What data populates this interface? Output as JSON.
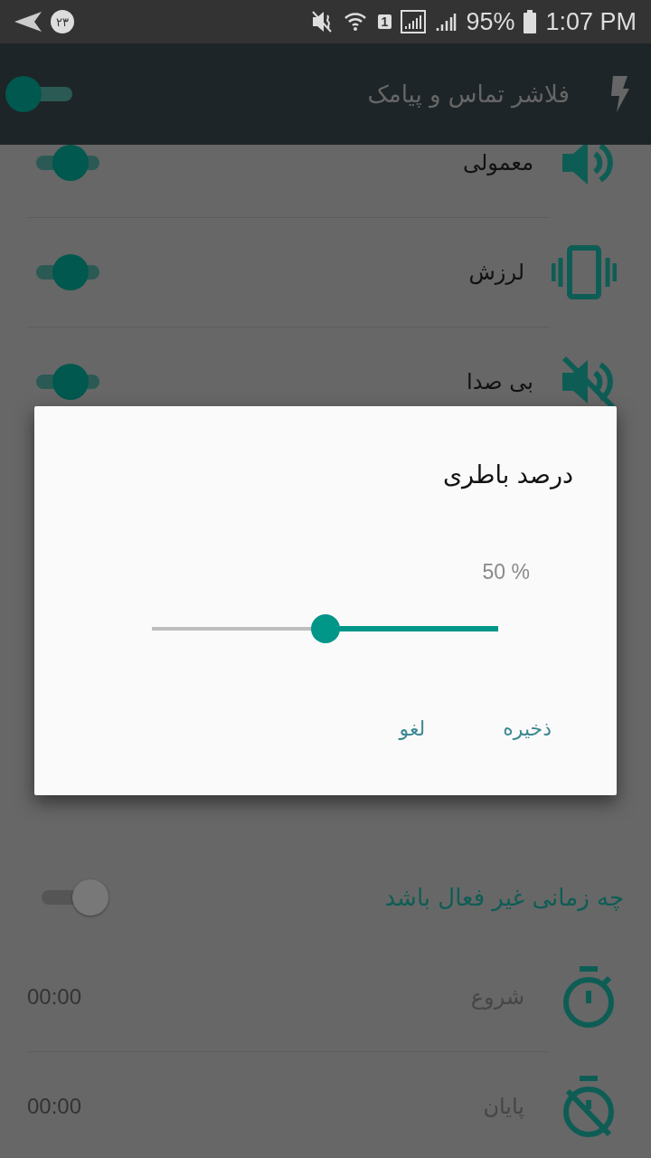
{
  "status_bar": {
    "notification_count": "۲۳",
    "sim_slot": "1",
    "battery": "95%",
    "time": "1:07 PM"
  },
  "app_bar": {
    "title": "فلاشر تماس و پیامک",
    "on": true
  },
  "sound_modes": [
    {
      "kind": "normal",
      "label": "معمولی",
      "on": true
    },
    {
      "kind": "vibrate",
      "label": "لرزش",
      "on": true
    },
    {
      "kind": "silent",
      "label": "بی صدا",
      "on": true
    }
  ],
  "schedule": {
    "title": "چه زمانی غیر فعال باشد",
    "on": false,
    "rows": [
      {
        "kind": "start",
        "label": "شروع",
        "value": "00:00"
      },
      {
        "kind": "end",
        "label": "پایان",
        "value": "00:00"
      }
    ]
  },
  "dialog": {
    "title": "درصد باطری",
    "reading": "50 %",
    "slider": {
      "level": 0.5
    },
    "buttons": [
      "ذخیره",
      "لغو"
    ]
  }
}
